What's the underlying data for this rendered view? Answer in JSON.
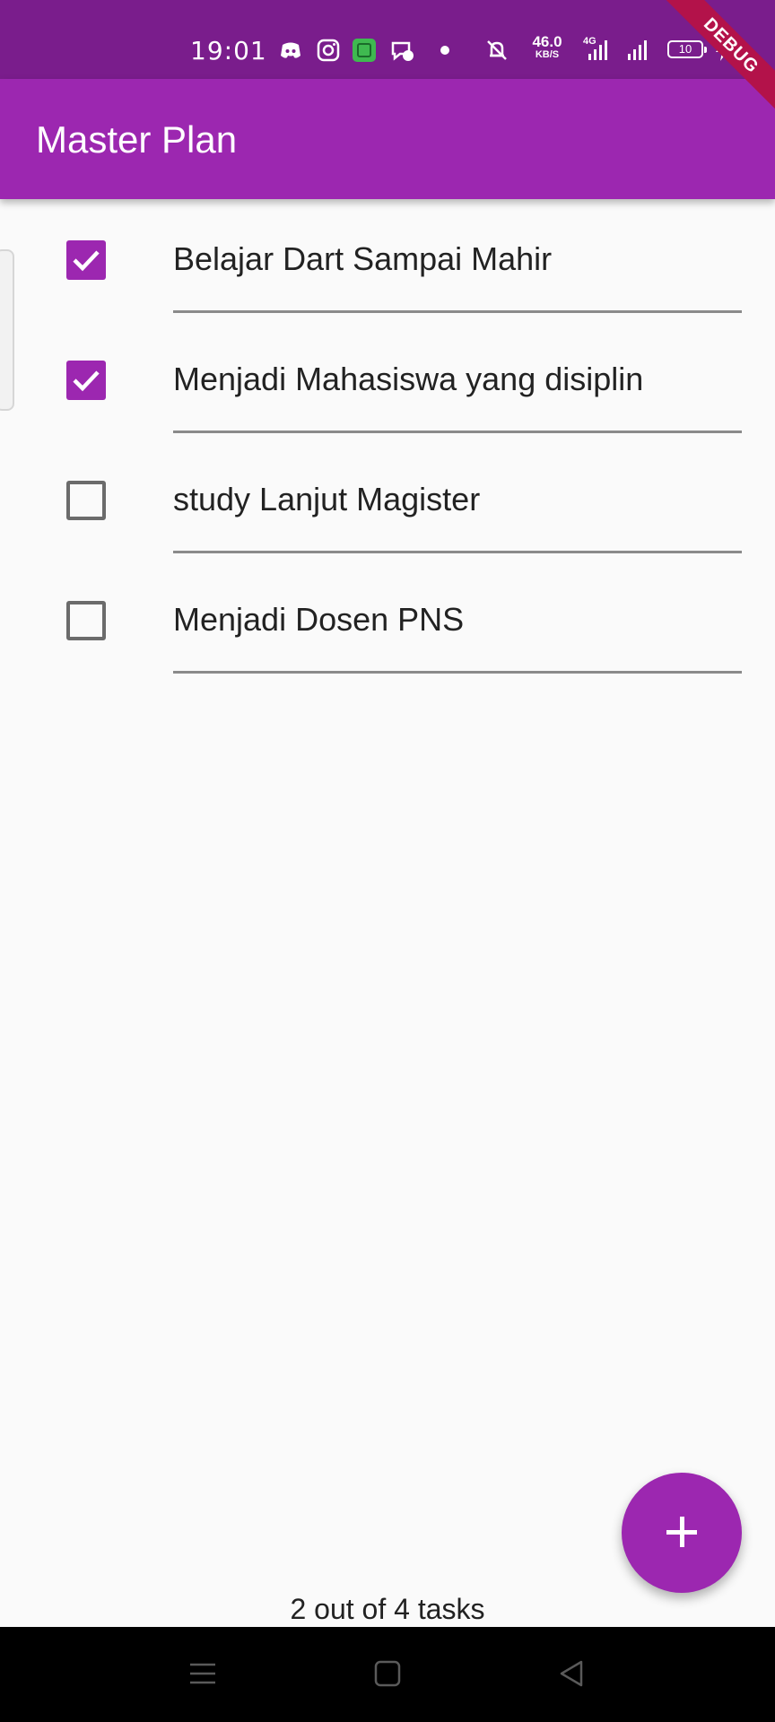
{
  "status_bar": {
    "time": "19:01",
    "net_speed_value": "46.0",
    "net_speed_unit": "KB/S",
    "battery_level": "10",
    "network_label": "4G",
    "icons": [
      "discord-icon",
      "instagram-icon",
      "app-icon",
      "messenger-icon",
      "dot-icon",
      "mute-icon",
      "signal-icon",
      "signal-icon",
      "battery-icon",
      "charging-icon"
    ]
  },
  "debug_banner": "DEBUG",
  "app_bar": {
    "title": "Master Plan"
  },
  "tasks": [
    {
      "label": "Belajar Dart Sampai Mahir",
      "checked": true
    },
    {
      "label": "Menjadi Mahasiswa yang disiplin",
      "checked": true
    },
    {
      "label": "study Lanjut Magister",
      "checked": false
    },
    {
      "label": "Menjadi Dosen PNS",
      "checked": false
    }
  ],
  "footer": {
    "count_text": "2 out of 4 tasks"
  },
  "fab": {
    "icon": "plus-icon"
  },
  "nav_bar": {
    "buttons": [
      "menu-icon",
      "home-icon",
      "back-icon"
    ]
  },
  "colors": {
    "primary": "#9c27b0",
    "status_bar": "#7a1d8c",
    "background": "#fafafa",
    "debug_ribbon": "#b3124a"
  }
}
